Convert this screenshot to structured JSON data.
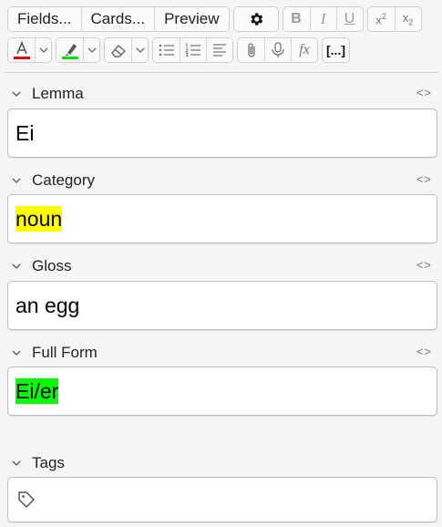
{
  "toolbar": {
    "fields_label": "Fields...",
    "cards_label": "Cards...",
    "preview_label": "Preview",
    "gear_icon": "gear-icon",
    "bold_label": "B",
    "italic_label": "I",
    "underline_label": "U",
    "superscript_label": "x",
    "superscript_mark": "2",
    "subscript_label": "x",
    "subscript_mark": "2",
    "font_color": "#e00000",
    "highlight_color": "#00e000",
    "cloze_label": "[...]",
    "mathjax_label": "fx"
  },
  "fields": [
    {
      "name": "Lemma",
      "value": "Ei",
      "highlight": ""
    },
    {
      "name": "Category",
      "value": "noun",
      "highlight": "#ffff00"
    },
    {
      "name": "Gloss",
      "value": "an egg",
      "highlight": ""
    },
    {
      "name": "Full Form",
      "value": "Ei/er",
      "highlight": "#00ff00"
    }
  ],
  "tags": {
    "label": "Tags",
    "value": ""
  }
}
